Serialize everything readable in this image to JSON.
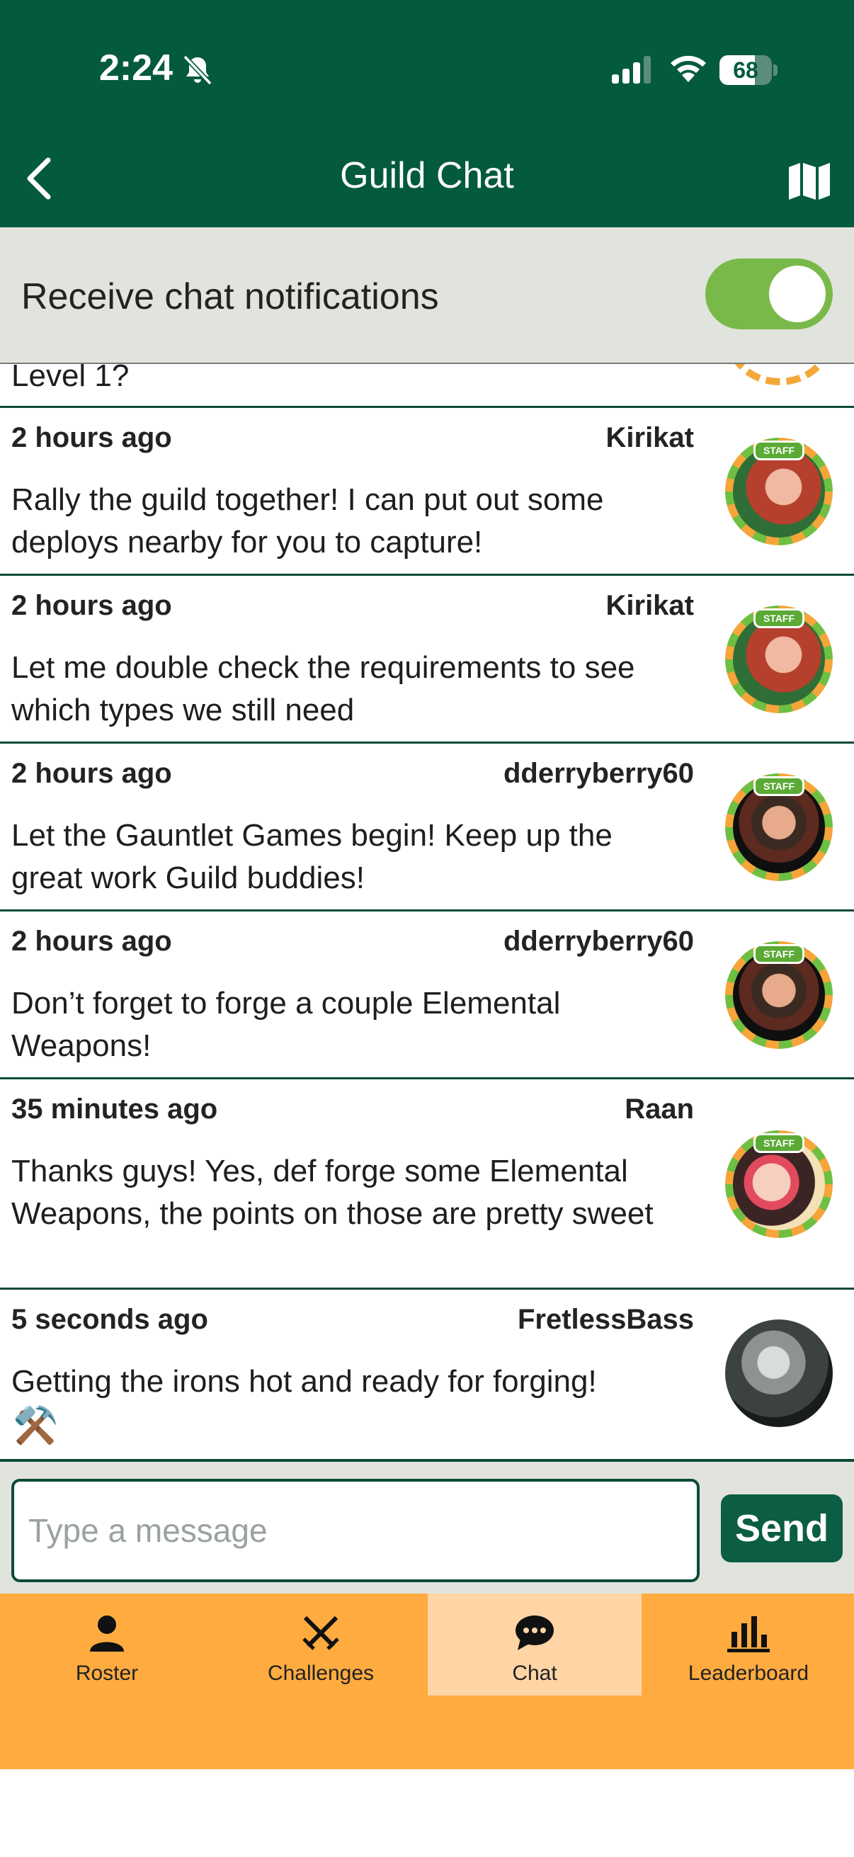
{
  "status_bar": {
    "time": "2:24",
    "battery": "68",
    "battery_level": 0.68
  },
  "header": {
    "title": "Guild Chat"
  },
  "notifications": {
    "label": "Receive chat notifications",
    "enabled": true
  },
  "partial_message": {
    "text": "Level 1?"
  },
  "messages": [
    {
      "time": "2 hours ago",
      "user": "Kirikat",
      "text": "Rally the guild together! I can put out some deploys nearby for you to capture!",
      "staff": true,
      "badge": "STAFF"
    },
    {
      "time": "2 hours ago",
      "user": "Kirikat",
      "text": "Let me double check the requirements to see which types we still need",
      "staff": true,
      "badge": "STAFF"
    },
    {
      "time": "2 hours ago",
      "user": "dderryberry60",
      "text": "Let the Gauntlet Games begin! Keep up the great work Guild buddies!",
      "staff": true,
      "badge": "STAFF"
    },
    {
      "time": "2 hours ago",
      "user": "dderryberry60",
      "text": "Don’t forget to forge a couple Elemental Weapons!",
      "staff": true,
      "badge": "STAFF"
    },
    {
      "time": "35 minutes ago",
      "user": "Raan",
      "text": "Thanks guys! Yes, def forge some Elemental Weapons, the points on those are pretty sweet",
      "staff": true,
      "badge": "STAFF"
    },
    {
      "time": "5 seconds ago",
      "user": "FretlessBass",
      "text": "Getting the irons hot and ready for forging!",
      "staff": false,
      "emoji": "⚒️"
    }
  ],
  "composer": {
    "placeholder": "Type a message",
    "value": "",
    "send_label": "Send"
  },
  "tabs": [
    {
      "label": "Roster",
      "icon": "person-icon",
      "active": false
    },
    {
      "label": "Challenges",
      "icon": "crossed-swords-icon",
      "active": false
    },
    {
      "label": "Chat",
      "icon": "chat-bubble-icon",
      "active": true
    },
    {
      "label": "Leaderboard",
      "icon": "bar-chart-icon",
      "active": false
    }
  ],
  "colors": {
    "header_bg": "#045a3e",
    "toggle_on": "#79b94a",
    "tabbar_bg": "#ffab3f",
    "tab_active_bg": "#ffd5a6",
    "send_bg": "#0b5e43"
  }
}
